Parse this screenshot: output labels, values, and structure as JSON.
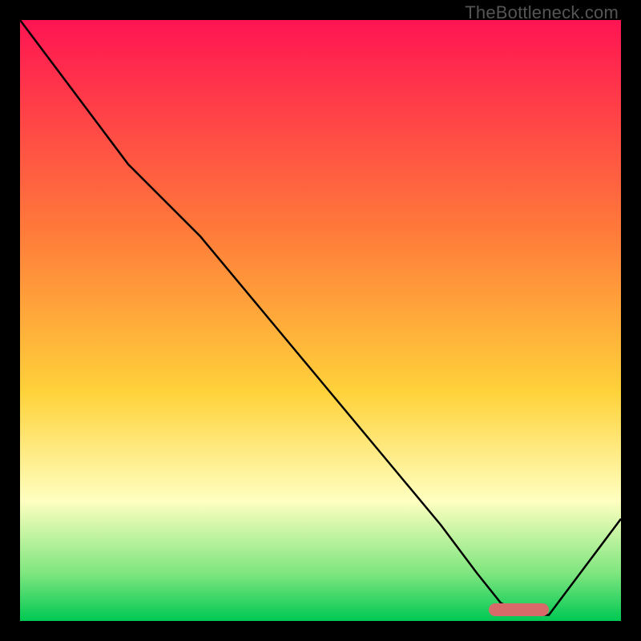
{
  "watermark": "TheBottleneck.com",
  "colors": {
    "top": "#ff1452",
    "mid1": "#ff7a3a",
    "mid2": "#ffd23a",
    "pale": "#ffffc0",
    "green_light": "#7fe67f",
    "green": "#00c853",
    "marker": "#d86a6a",
    "curve": "#000000"
  },
  "chart_data": {
    "type": "line",
    "title": "",
    "xlabel": "",
    "ylabel": "",
    "xlim": [
      0,
      100
    ],
    "ylim": [
      0,
      100
    ],
    "x": [
      0,
      6,
      12,
      18,
      24,
      30,
      40,
      50,
      60,
      70,
      76,
      80,
      84,
      88,
      100
    ],
    "values": [
      100,
      92,
      84,
      76,
      70,
      64,
      52,
      40,
      28,
      16,
      8,
      3,
      1,
      1,
      17
    ],
    "optimal_range_x": [
      78,
      88
    ],
    "gradient_stops": [
      {
        "pct": 0,
        "color": "#ff1452"
      },
      {
        "pct": 35,
        "color": "#ff7a3a"
      },
      {
        "pct": 62,
        "color": "#ffd23a"
      },
      {
        "pct": 80,
        "color": "#ffffc0"
      },
      {
        "pct": 92,
        "color": "#7fe67f"
      },
      {
        "pct": 100,
        "color": "#00c853"
      }
    ]
  }
}
